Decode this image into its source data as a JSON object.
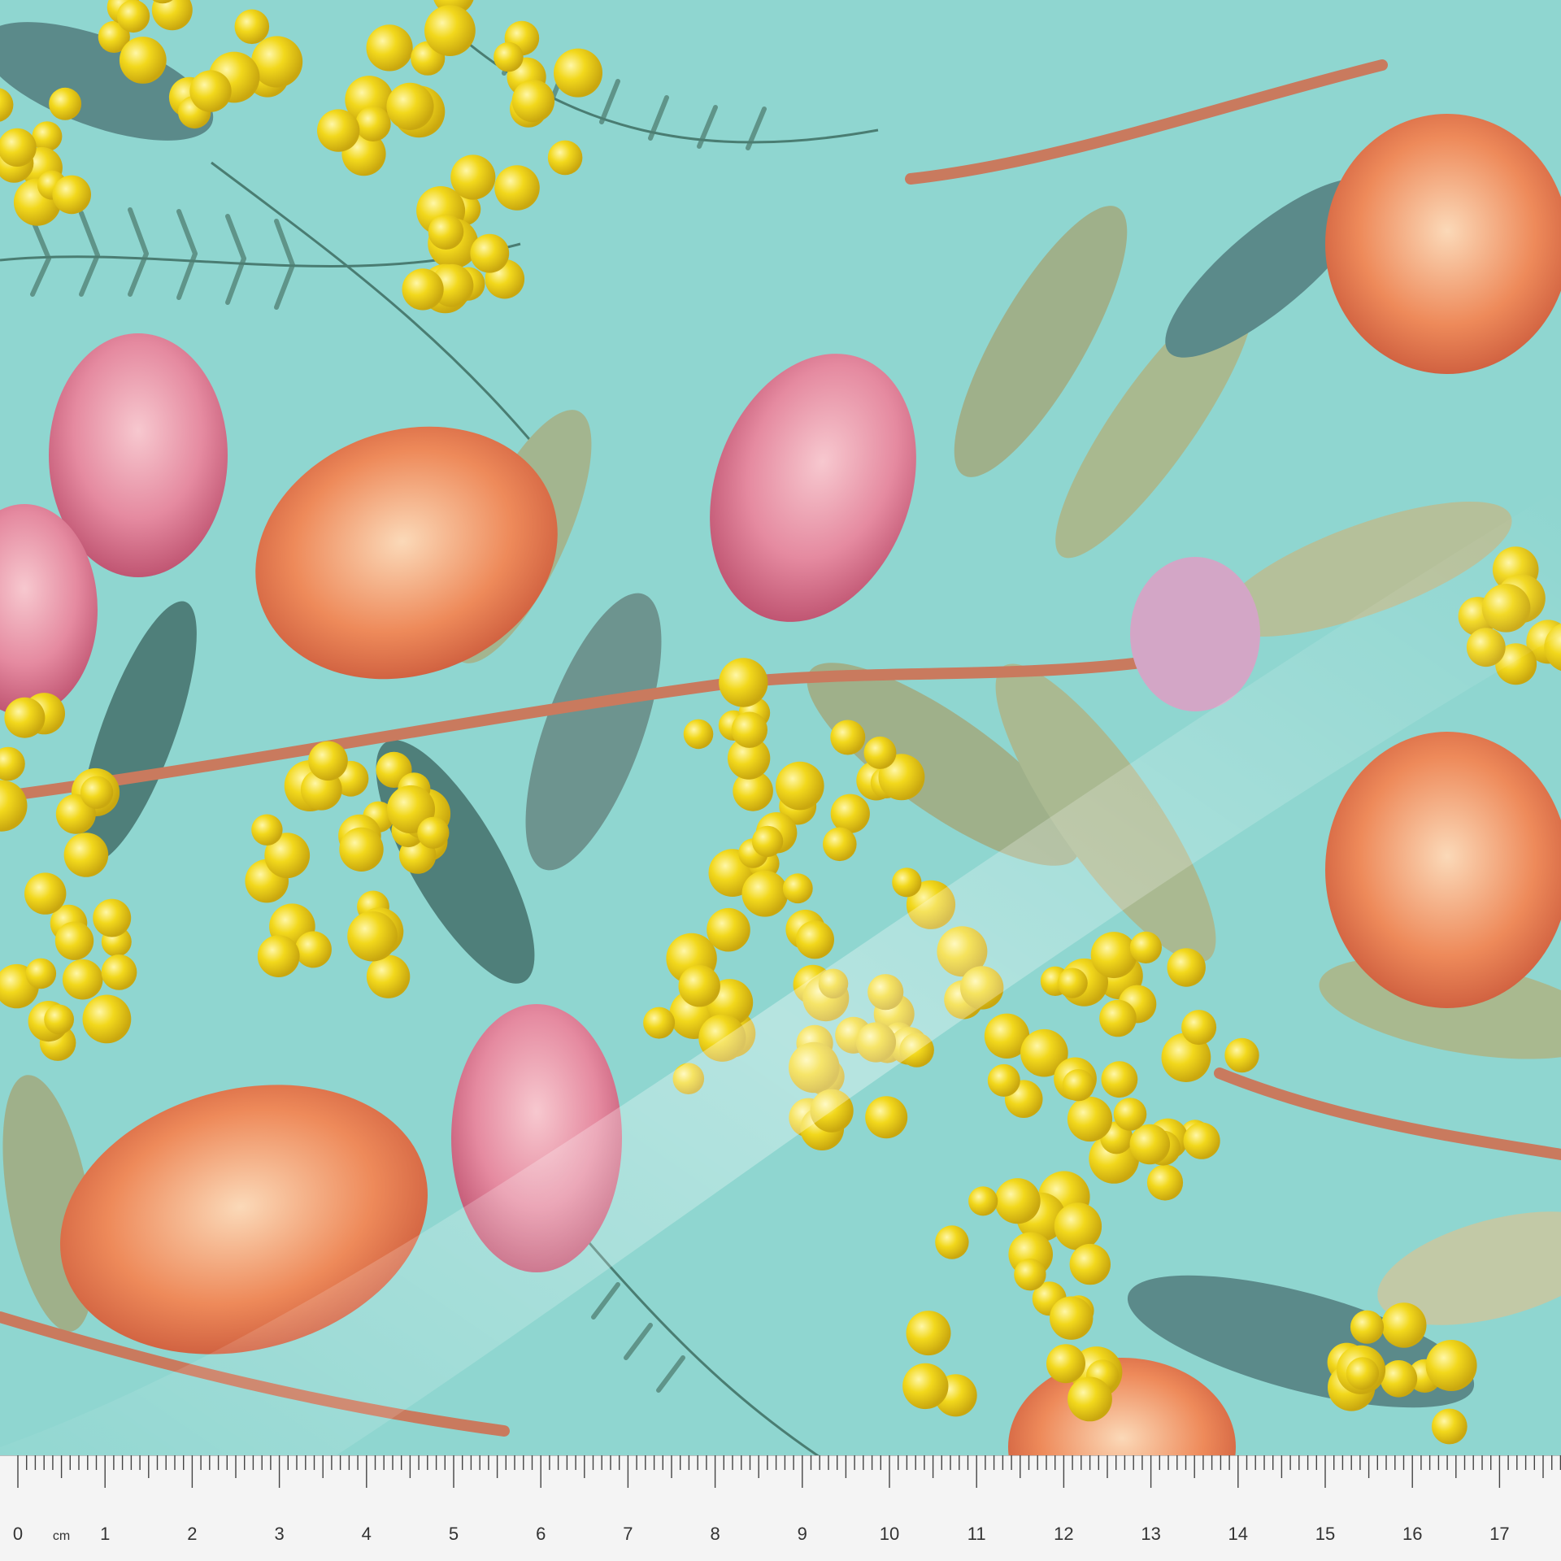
{
  "palette": {
    "background": "#8fd6d0",
    "wattle_yellow": "#f2d81c",
    "wattle_shadow": "#c9a70f",
    "protea_pink": "#e58aa0",
    "banksia_orange": "#ee8a5a",
    "leaf_sage": "#9fb08a",
    "leaf_teal": "#5b8a8a",
    "stem": "#c97a5e",
    "ruler": "#f4f4f4"
  },
  "ruler": {
    "unit_label": "cm",
    "labels": [
      "0",
      "1",
      "2",
      "3",
      "4",
      "5",
      "6",
      "7",
      "8",
      "9",
      "10",
      "11",
      "12",
      "13",
      "14",
      "15",
      "16",
      "17"
    ]
  }
}
